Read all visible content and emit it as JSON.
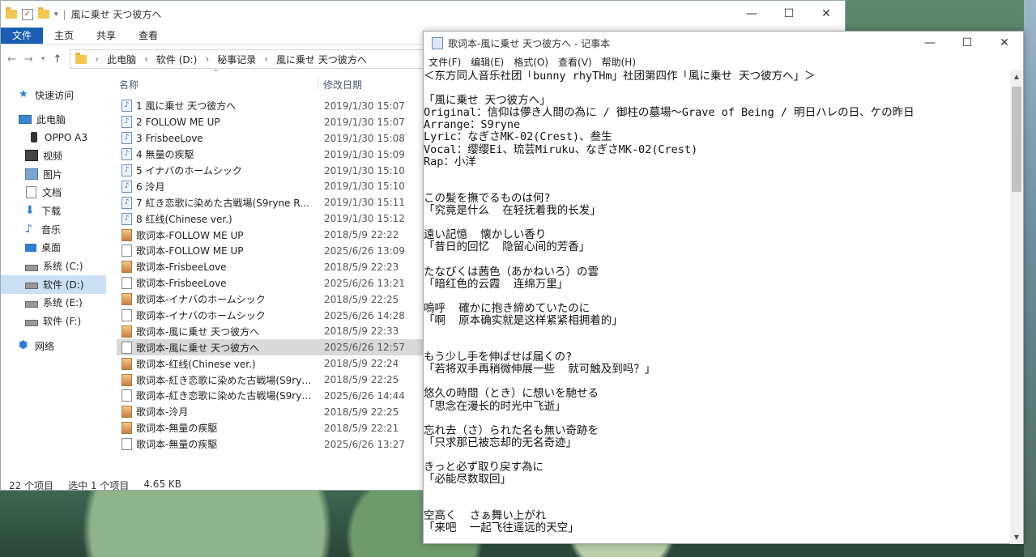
{
  "explorer": {
    "title": "風に乗せ 天つ彼方へ",
    "controls": [
      "—",
      "☐",
      "✕"
    ],
    "ribbon": [
      "文件",
      "主页",
      "共享",
      "查看"
    ],
    "address": [
      "此电脑",
      "软件 (D:)",
      "秘事记录",
      "風に乗せ 天つ彼方へ"
    ],
    "nav": [
      {
        "label": "快速访问",
        "icon": "star-icon"
      },
      {
        "label": "此电脑",
        "icon": "computer-icon"
      },
      {
        "label": "OPPO A3",
        "icon": "phone-icon"
      },
      {
        "label": "视频",
        "icon": "video-icon"
      },
      {
        "label": "图片",
        "icon": "picture-icon"
      },
      {
        "label": "文档",
        "icon": "document-icon"
      },
      {
        "label": "下载",
        "icon": "download-icon"
      },
      {
        "label": "音乐",
        "icon": "music-icon"
      },
      {
        "label": "桌面",
        "icon": "desktop-icon"
      },
      {
        "label": "系统 (C:)",
        "icon": "drive-icon"
      },
      {
        "label": "软件 (D:)",
        "icon": "drive-icon"
      },
      {
        "label": "系统 (E:)",
        "icon": "drive-icon"
      },
      {
        "label": "软件 (F:)",
        "icon": "drive-icon"
      },
      {
        "label": "网络",
        "icon": "network-icon"
      }
    ],
    "columns": {
      "name": "名称",
      "date": "修改日期"
    },
    "files": [
      {
        "name": "1 風に乗せ 天つ彼方へ",
        "date": "2019/1/30 15:07",
        "type": "audio"
      },
      {
        "name": "2 FOLLOW ME UP",
        "date": "2019/1/30 15:07",
        "type": "audio"
      },
      {
        "name": "3 FrisbeeLove",
        "date": "2019/1/30 15:08",
        "type": "audio"
      },
      {
        "name": "4 無量の疾駆",
        "date": "2019/1/30 15:09",
        "type": "audio"
      },
      {
        "name": "5 イナバのホームシック",
        "date": "2019/1/30 15:10",
        "type": "audio"
      },
      {
        "name": "6 泠月",
        "date": "2019/1/30 15:10",
        "type": "audio"
      },
      {
        "name": "7 紅き恋歌に染めた古戦場(S9ryne Rem...",
        "date": "2019/1/30 15:11",
        "type": "audio"
      },
      {
        "name": "8 红线(Chinese ver.)",
        "date": "2019/1/30 15:12",
        "type": "audio"
      },
      {
        "name": "歌词本-FOLLOW ME UP",
        "date": "2018/5/9 22:22",
        "type": "img"
      },
      {
        "name": "歌词本-FOLLOW ME UP",
        "date": "2025/6/26 13:09",
        "type": "txt"
      },
      {
        "name": "歌词本-FrisbeeLove",
        "date": "2018/5/9 22:23",
        "type": "img"
      },
      {
        "name": "歌词本-FrisbeeLove",
        "date": "2025/6/26 13:21",
        "type": "txt"
      },
      {
        "name": "歌词本-イナバのホームシック",
        "date": "2018/5/9 22:25",
        "type": "img"
      },
      {
        "name": "歌词本-イナバのホームシック",
        "date": "2025/6/26 14:28",
        "type": "txt"
      },
      {
        "name": "歌词本-風に乗せ 天つ彼方へ",
        "date": "2018/5/9 22:33",
        "type": "img"
      },
      {
        "name": "歌词本-風に乗せ 天つ彼方へ",
        "date": "2025/6/26 12:57",
        "type": "txt",
        "selected": true
      },
      {
        "name": "歌词本-红线(Chinese ver.)",
        "date": "2018/5/9 22:24",
        "type": "img"
      },
      {
        "name": "歌词本-紅き恋歌に染めた古戦場(S9ryne...",
        "date": "2018/5/9 22:25",
        "type": "img"
      },
      {
        "name": "歌词本-紅き恋歌に染めた古戦場(S9ryne...",
        "date": "2025/6/26 14:44",
        "type": "txt"
      },
      {
        "name": "歌词本-泠月",
        "date": "2018/5/9 22:25",
        "type": "img"
      },
      {
        "name": "歌词本-無量の疾駆",
        "date": "2018/5/9 22:21",
        "type": "img"
      },
      {
        "name": "歌词本-無量の疾駆",
        "date": "2025/6/26 13:27",
        "type": "txt"
      }
    ],
    "status": {
      "count": "22 个项目",
      "selected": "选中 1 个项目",
      "size": "4.65 KB"
    }
  },
  "notepad": {
    "title": "歌词本-風に乗せ 天つ彼方へ - 记事本",
    "controls": [
      "—",
      "☐",
      "✕"
    ],
    "menu": [
      "文件(F)",
      "编辑(E)",
      "格式(O)",
      "查看(V)",
      "帮助(H)"
    ],
    "lines": [
      "＜东方同人音乐社团「bunny rhyTHm」社团第四作「風に乗せ 天つ彼方へ」＞",
      "",
      "「風に乗せ 天つ彼方へ」",
      "Original：信仰は儚き人間の為に / 御柱の墓場～Grave of Being / 明日ハレの日、ケの昨日",
      "Arrange：S9ryne",
      "Lyric：なぎさMK-02(Crest)、叁生",
      "Vocal：缨缨Ei、琉芸Miruku、なぎさMK-02(Crest)",
      "Rap：小洋",
      "",
      "",
      "この髪を撫でるものは何?",
      "「究竟是什么  在轻抚着我的长发」",
      "",
      "遠い記憶  懐かしい香り",
      "「昔日的回忆  隐留心间的芳香」",
      "",
      "たなびくは茜色（あかねいろ）の雲",
      "「暗红色的云霞  连绵万里」",
      "",
      "嗚呼  確かに抱き締めていたのに",
      "「啊  原本确实就是这样紧紧相拥着的」",
      "",
      "",
      "もう少し手を伸ばせば届くの?",
      "「若将双手再稍微伸展一些  就可触及到吗？」",
      "",
      "悠久の時間（とき）に想いを馳せる",
      "「思念在漫长的时光中飞逝」",
      "",
      "忘れ去（さ）られた名も無い奇跡を",
      "「只求那已被忘却的无名奇迹」",
      "",
      "きっと必ず取り戻す為に",
      "「必能尽数取回」",
      "",
      "",
      "空高く  さぁ舞い上がれ",
      "「来吧  一起飞往遥远的天空」"
    ]
  }
}
